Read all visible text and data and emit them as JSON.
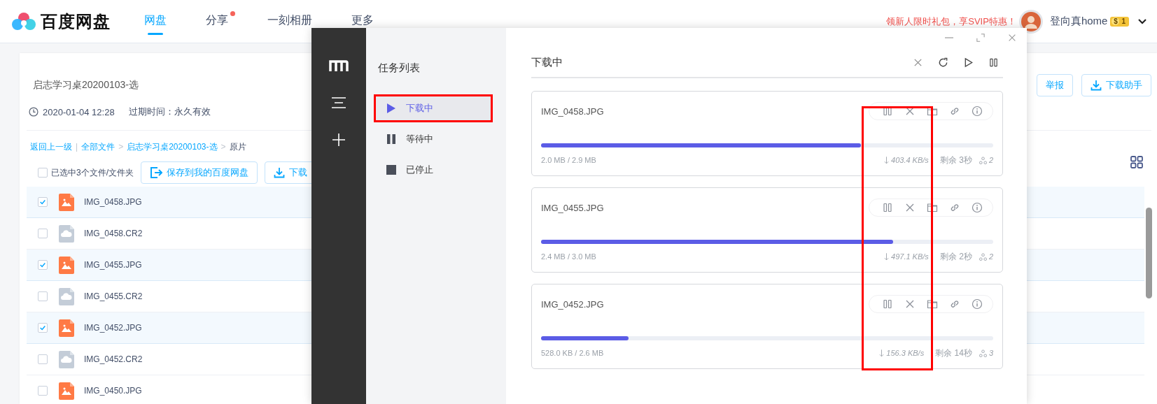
{
  "header": {
    "logo_text": "百度网盘",
    "nav": [
      {
        "label": "网盘",
        "selected": true,
        "badge": false
      },
      {
        "label": "分享",
        "selected": false,
        "badge": true
      },
      {
        "label": "一刻相册",
        "selected": false,
        "badge": false
      },
      {
        "label": "更多",
        "selected": false,
        "badge": false
      }
    ],
    "promo": "领新人限时礼包，享SVIP特惠！",
    "user_name": "登向真home",
    "vip": {
      "symbol": "$",
      "rank": "1"
    }
  },
  "share": {
    "title": "启志学习桌20200103-选",
    "date": "2020-01-04 12:28",
    "expiry": "过期时间：永久有效",
    "actions": [
      {
        "label": "举报",
        "kind": "plain"
      },
      {
        "label": "下载助手",
        "kind": "download"
      }
    ],
    "breadcrumb": [
      {
        "label": "返回上一级",
        "kind": "link"
      },
      {
        "label": "|",
        "kind": "divider"
      },
      {
        "label": "全部文件",
        "kind": "link"
      },
      {
        "label": ">",
        "kind": "separator"
      },
      {
        "label": "启志学习桌20200103-选",
        "kind": "link"
      },
      {
        "label": ">",
        "kind": "separator"
      },
      {
        "label": "原片",
        "kind": "current"
      }
    ],
    "select_all": {
      "label": "已选中3个文件/文件夹",
      "checked": false
    },
    "toolbar": [
      {
        "label": "保存到我的百度网盘",
        "kind": "save"
      },
      {
        "label": "下载",
        "kind": "download"
      }
    ],
    "files": [
      {
        "name": "IMG_0458.JPG",
        "kind": "image",
        "checked": true
      },
      {
        "name": "IMG_0458.CR2",
        "kind": "raw",
        "checked": false
      },
      {
        "name": "IMG_0455.JPG",
        "kind": "image",
        "checked": true
      },
      {
        "name": "IMG_0455.CR2",
        "kind": "raw",
        "checked": false
      },
      {
        "name": "IMG_0452.JPG",
        "kind": "image",
        "checked": true
      },
      {
        "name": "IMG_0452.CR2",
        "kind": "raw",
        "checked": false
      },
      {
        "name": "IMG_0450.JPG",
        "kind": "image",
        "checked": false
      }
    ]
  },
  "downloader": {
    "sidebar_title": "任务列表",
    "sidebar_items": [
      {
        "label": "下载中",
        "kind": "play",
        "selected": true
      },
      {
        "label": "等待中",
        "kind": "pause",
        "selected": false
      },
      {
        "label": "已停止",
        "kind": "stop",
        "selected": false
      }
    ],
    "title": "下载中",
    "tasks": [
      {
        "name": "IMG_0458.JPG",
        "level": 0.708,
        "size": "2.0 MB / 2.9 MB",
        "speed": "403.4 KB/s",
        "remaining": "剩余 3秒",
        "peers": "2"
      },
      {
        "name": "IMG_0455.JPG",
        "level": 0.778,
        "size": "2.4 MB / 3.0 MB",
        "speed": "497.1 KB/s",
        "remaining": "剩余 2秒",
        "peers": "2"
      },
      {
        "name": "IMG_0452.JPG",
        "level": 0.194,
        "size": "528.0 KB / 2.6 MB",
        "speed": "156.3 KB/s",
        "remaining": "剩余 14秒",
        "peers": "3"
      }
    ]
  }
}
